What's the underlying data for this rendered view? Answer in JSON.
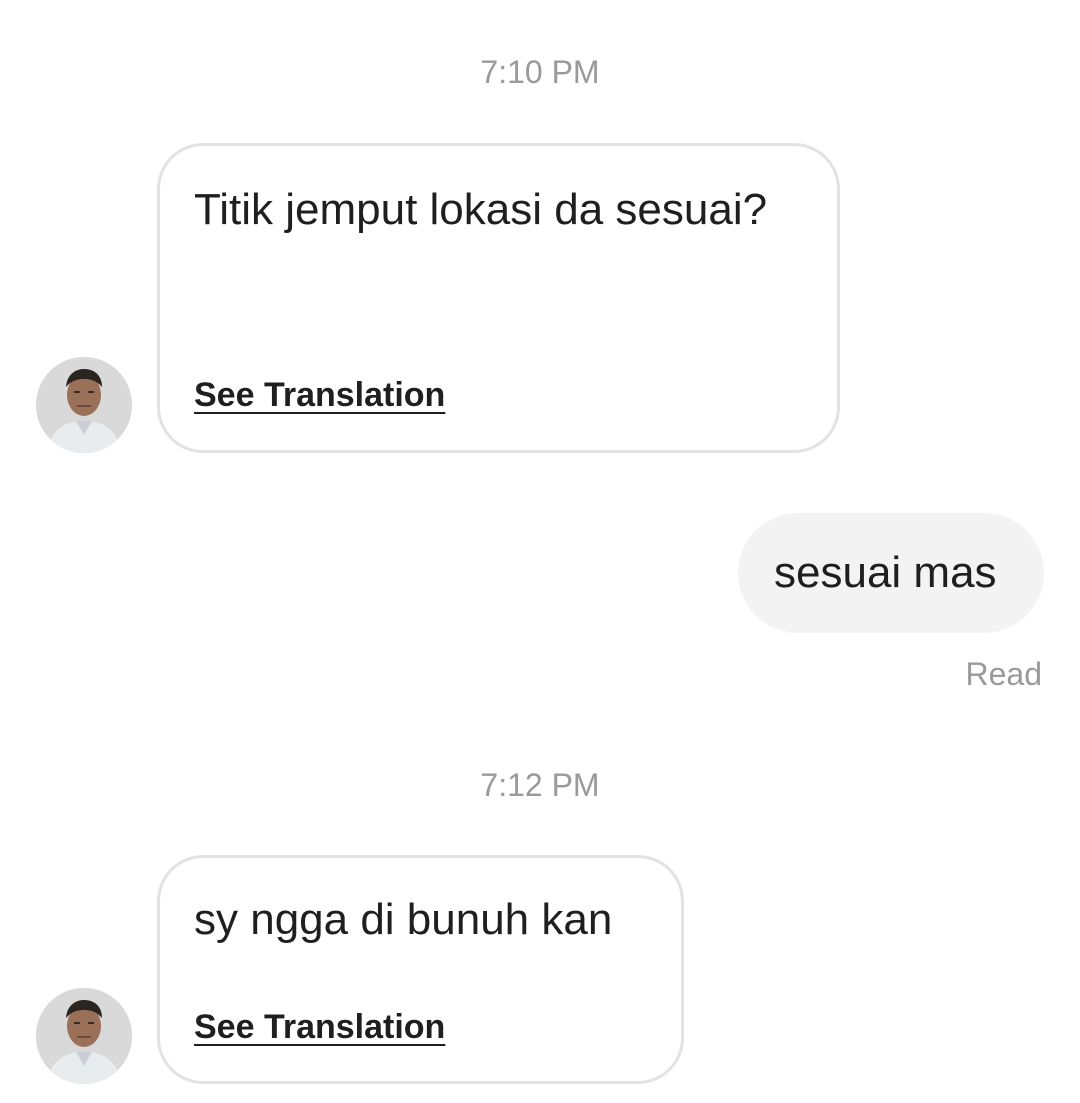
{
  "conversation": {
    "groups": [
      {
        "timestamp": "7:10 PM",
        "incoming_text": "Titik jemput lokasi da sesuai?",
        "translation_link": "See Translation"
      },
      {
        "outgoing_text": "sesuai mas",
        "status": "Read"
      },
      {
        "timestamp": "7:12 PM",
        "incoming_text": "sy ngga di bunuh kan",
        "translation_link": "See Translation"
      }
    ]
  },
  "icons": {
    "avatar": "person-photo-avatar"
  }
}
